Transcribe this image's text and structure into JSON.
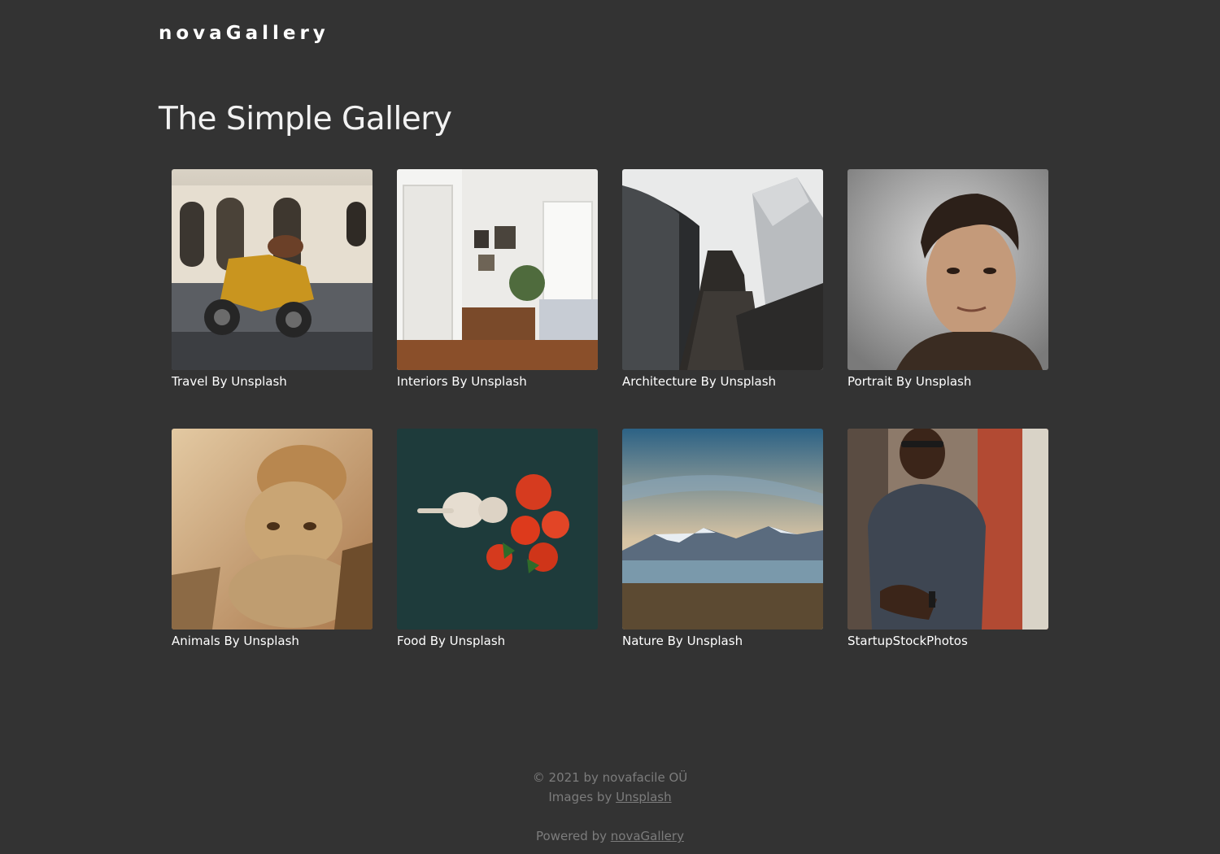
{
  "header": {
    "brand": "novaGallery"
  },
  "main": {
    "title": "The Simple Gallery"
  },
  "gallery": {
    "items": [
      {
        "caption": "Travel By Unsplash"
      },
      {
        "caption": "Interiors By Unsplash"
      },
      {
        "caption": "Architecture By Unsplash"
      },
      {
        "caption": "Portrait By Unsplash"
      },
      {
        "caption": "Animals By Unsplash"
      },
      {
        "caption": "Food By Unsplash"
      },
      {
        "caption": "Nature By Unsplash"
      },
      {
        "caption": "StartupStockPhotos"
      }
    ]
  },
  "footer": {
    "copyright": "© 2021 by novafacile OÜ",
    "images_prefix": "Images by",
    "images_link": "Unsplash",
    "powered_prefix": "Powered by",
    "powered_link": "novaGallery"
  },
  "colors": {
    "background": "#333333",
    "text": "#ffffff",
    "footer_text": "#7c7c7c"
  }
}
